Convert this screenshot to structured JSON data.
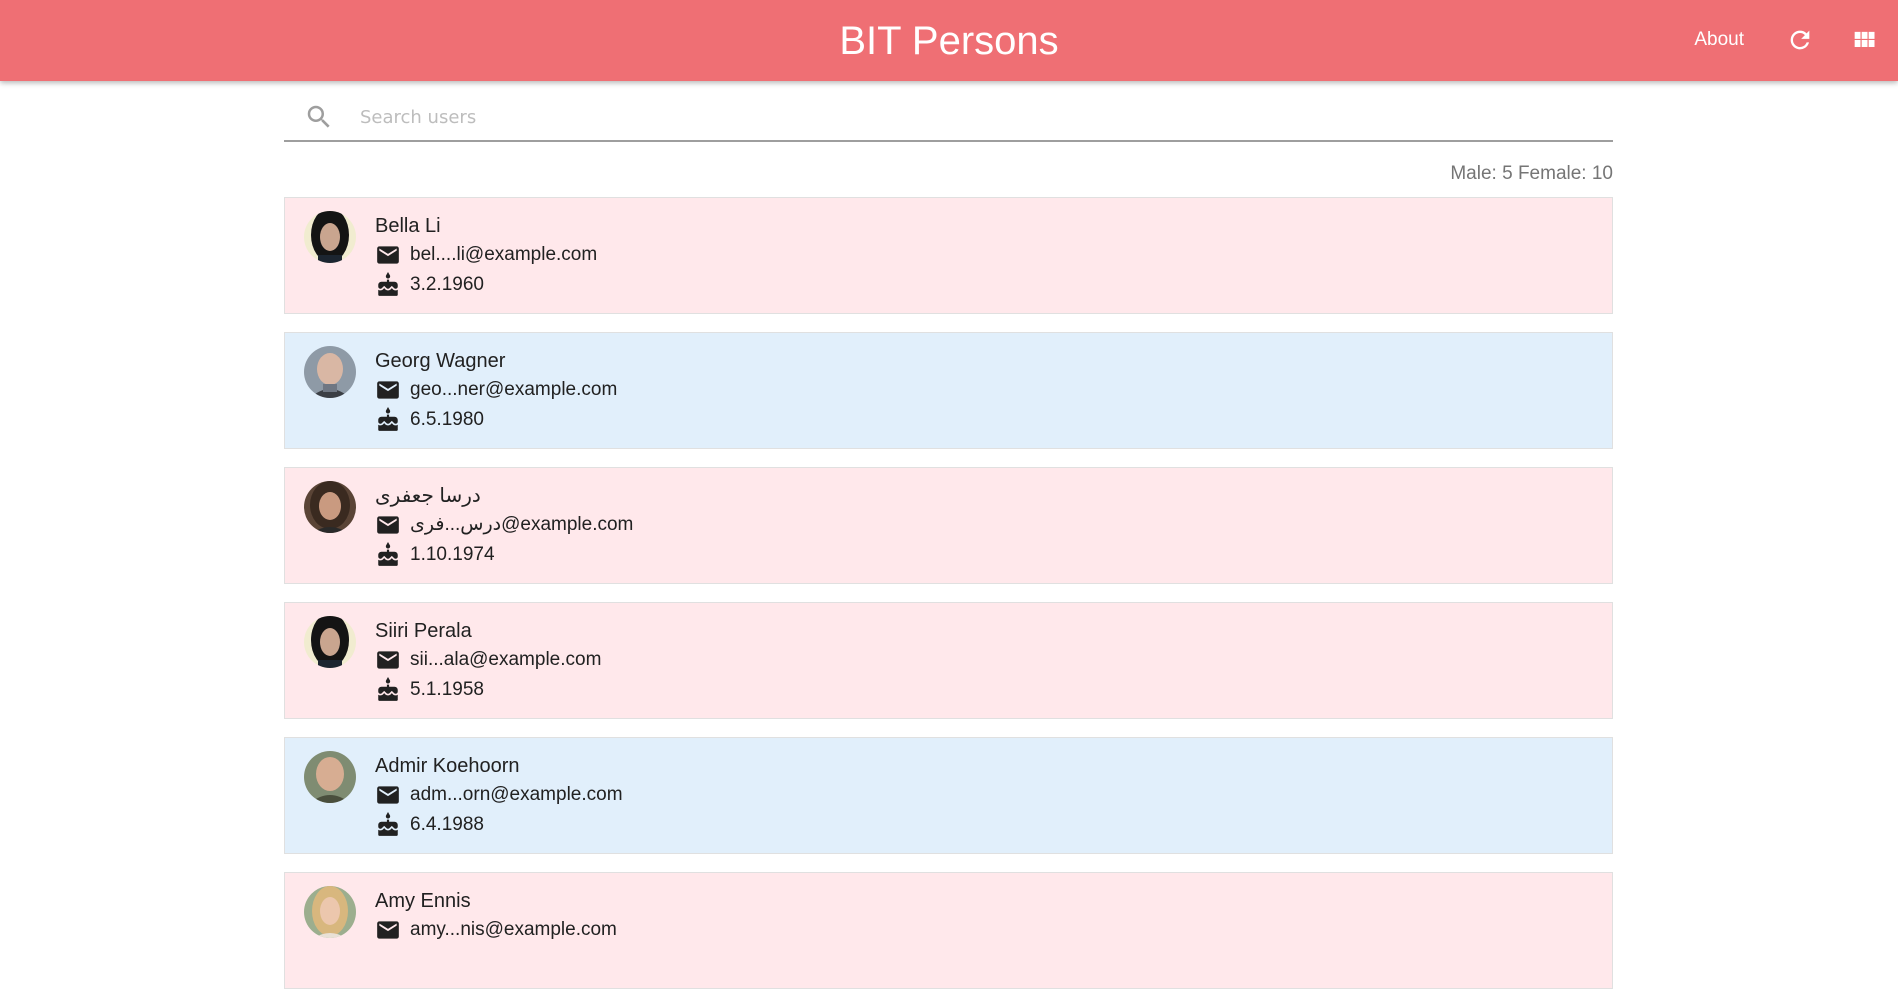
{
  "header": {
    "title": "BIT Persons",
    "about_label": "About",
    "refresh_icon": "refresh-icon",
    "view_icon": "grid-view-icon",
    "bar_color": "#ef6f74"
  },
  "search": {
    "placeholder": "Search users",
    "value": "",
    "icon": "search-icon"
  },
  "stats": {
    "text": "Male: 5 Female: 10"
  },
  "users": [
    {
      "name": "Bella Li",
      "email": "bel....li@example.com",
      "dob": "3.2.1960",
      "gender": "female"
    },
    {
      "name": "Georg Wagner",
      "email": "geo...ner@example.com",
      "dob": "6.5.1980",
      "gender": "male"
    },
    {
      "name": "درسا جعفری",
      "email": "درس...فری@example.com",
      "dob": "1.10.1974",
      "gender": "female"
    },
    {
      "name": "Siiri Perala",
      "email": "sii...ala@example.com",
      "dob": "5.1.1958",
      "gender": "female"
    },
    {
      "name": "Admir Koehoorn",
      "email": "adm...orn@example.com",
      "dob": "6.4.1988",
      "gender": "male"
    },
    {
      "name": "Amy Ennis",
      "email": "amy...nis@example.com",
      "dob": "",
      "gender": "female"
    }
  ],
  "colors": {
    "female_card": "#ffe8eb",
    "male_card": "#e1effb"
  }
}
